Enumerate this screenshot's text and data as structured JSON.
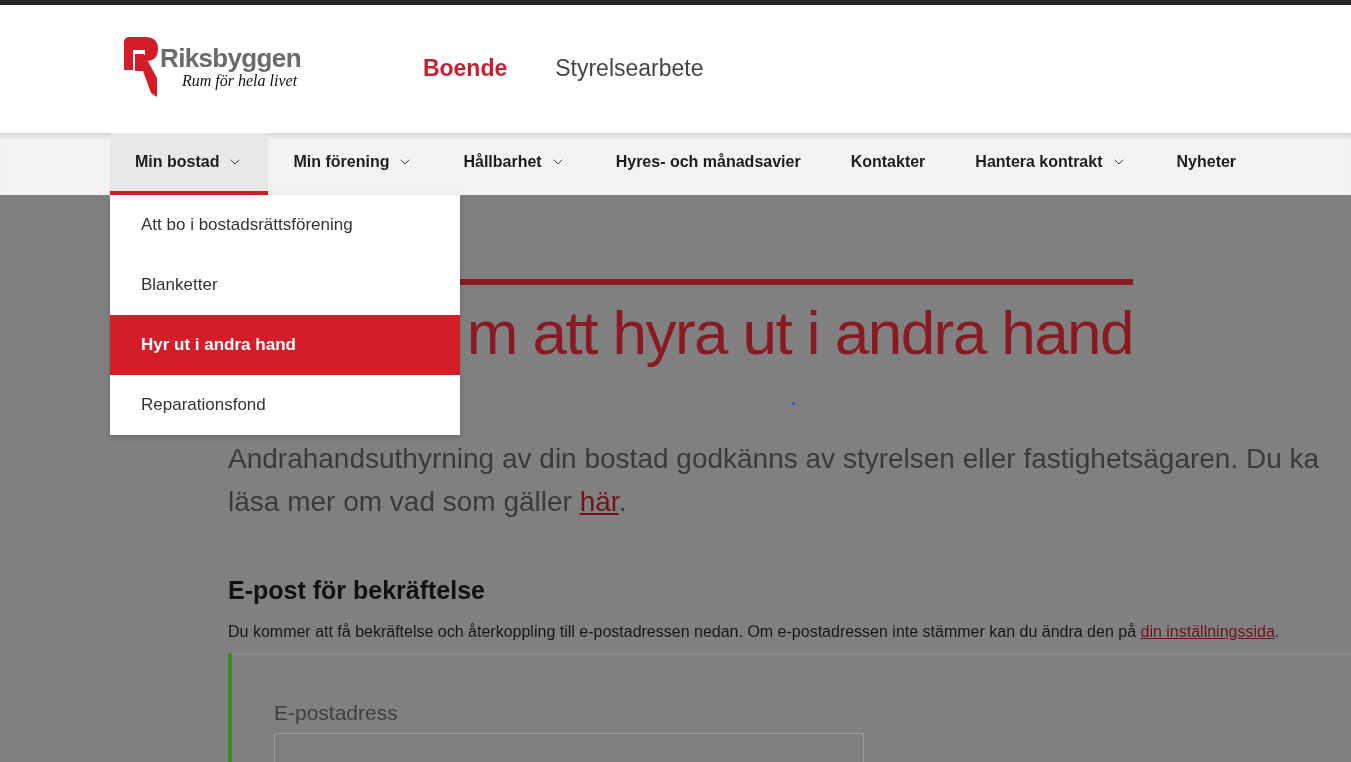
{
  "header": {
    "brand": {
      "name": "Riksbyggen",
      "tagline": "Rum för hela livet"
    },
    "top_nav": [
      {
        "label": "Boende",
        "selected": true
      },
      {
        "label": "Styrelsearbete",
        "selected": false
      }
    ]
  },
  "main_nav": [
    {
      "label": "Min bostad",
      "kind": "menu",
      "selected": true,
      "items": [
        {
          "label": "Att bo i bostadsrättsförening",
          "selected": false
        },
        {
          "label": "Blanketter",
          "selected": false
        },
        {
          "label": "Hyr ut i andra hand",
          "selected": true
        },
        {
          "label": "Reparationsfond",
          "selected": false
        }
      ]
    },
    {
      "label": "Min förening",
      "kind": "menu",
      "selected": false
    },
    {
      "label": "Hållbarhet",
      "kind": "menu",
      "selected": false
    },
    {
      "label": "Hyres- och månadsavier",
      "kind": "link",
      "selected": false
    },
    {
      "label": "Kontakter",
      "kind": "link",
      "selected": false
    },
    {
      "label": "Hantera kontrakt",
      "kind": "menu",
      "selected": false
    },
    {
      "label": "Nyheter",
      "kind": "link",
      "selected": false
    }
  ],
  "page": {
    "title": "m att hyra ut i andra hand",
    "intro": {
      "line_1": "Andrahandsuthyrning av din bostad godkänns av styrelsen eller fastighetsägaren. Du ka",
      "line_2": "läsa mer om vad som gäller",
      "link": "här",
      "end": "."
    },
    "email_section": {
      "heading": "E-post för bekräftelse",
      "text": "Du kommer att få bekräftelse och återkoppling till e-postadressen nedan. Om e-postadressen inte stämmer kan du ändra den på",
      "link": "din inställningssida",
      "end": ".",
      "field_label": "E-postadress"
    }
  }
}
